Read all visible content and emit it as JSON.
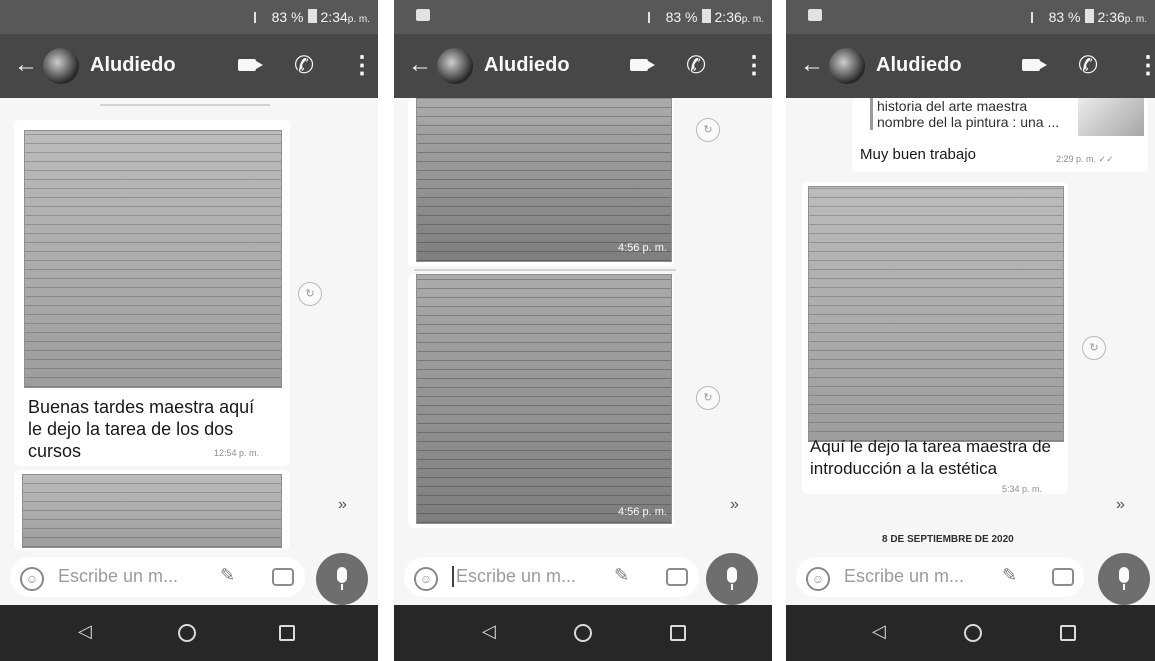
{
  "status": {
    "battery": "83 %",
    "time_1": "2:34",
    "time_2": "2:36",
    "time_3": "2:36",
    "suffix": "p. m."
  },
  "header": {
    "contact_name": "Aludiedo"
  },
  "panel1": {
    "message_text": "Buenas tardes maestra aquí le dejo la tarea de los dos cursos",
    "message_time": "12:54 p. m."
  },
  "panel2": {
    "photo1_time": "4:56 p. m.",
    "photo2_time": "4:56 p. m."
  },
  "panel3": {
    "quoted_text": "historia del arte maestra nombre del la pintura : una ...",
    "reply_text": "Muy buen trabajo",
    "reply_time": "2:29 p. m. ✓✓",
    "message_text": "Aquí le dejo la tarea maestra de introducción a la estética",
    "message_time": "5:34 p. m.",
    "date_separator": "8 DE SEPTIEMBRE DE 2020"
  },
  "input": {
    "placeholder": "Escribe un m..."
  },
  "icons": {
    "back": "←",
    "more": "⋮",
    "call": "✆",
    "emoji": "☺",
    "attach": "✎",
    "share": "↻",
    "chevron": "»",
    "nav_back": "◁"
  },
  "colors": {
    "appbar": "#4a4a4a",
    "chat_bg": "#f1f1ee",
    "navbar": "#2b2b2b"
  }
}
